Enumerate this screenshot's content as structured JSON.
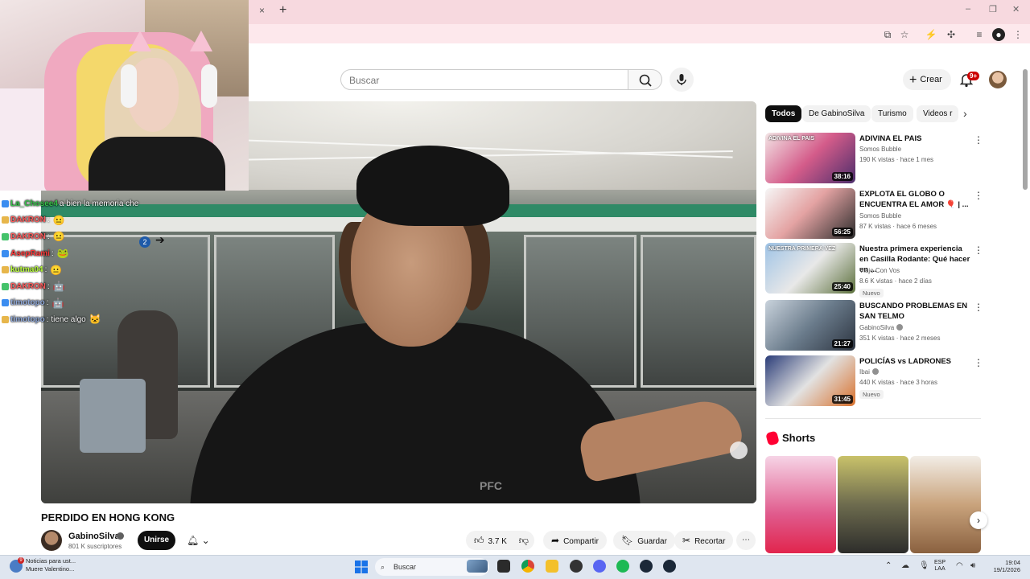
{
  "browser": {
    "tab_close": "×",
    "tab_new": "+",
    "window_controls": [
      "–",
      "❐",
      "✕"
    ]
  },
  "header": {
    "search_placeholder": "Buscar",
    "create_label": "Crear",
    "notifications_badge": "9+"
  },
  "video": {
    "title": "PERDIDO EN HONG KONG",
    "channel": "GabinoSilva",
    "subscribers": "801 K suscriptores",
    "join_label": "Unirse",
    "likes": "3.7 K",
    "share_label": "Compartir",
    "save_label": "Guardar",
    "clip_label": "Recortar",
    "logo_text": "PFC"
  },
  "chat": [
    {
      "name": "La_Chosee4",
      "msg": "a bien la memoria che",
      "color": "#35c24a",
      "emote": ""
    },
    {
      "name": "DAKRON",
      "msg": ":",
      "color": "#ff5b5b",
      "emote": "😐"
    },
    {
      "name": "DAKRON",
      "msg": ":",
      "color": "#ff5b5b",
      "emote": "😐"
    },
    {
      "name": "AsepRami",
      "msg": ":",
      "color": "#ff3a3a",
      "emote": "🐸"
    },
    {
      "name": "kutma04",
      "msg": ":",
      "color": "#b8ff3a",
      "emote": "😐"
    },
    {
      "name": "DAKRON",
      "msg": ":",
      "color": "#ff5b5b",
      "emote": "🤖"
    },
    {
      "name": "timotopo",
      "msg": ":",
      "color": "#8fa8d8",
      "emote": "🤖"
    },
    {
      "name": "timotopo",
      "msg": ": tiene algo",
      "color": "#8fa8d8",
      "emote": "🐱"
    }
  ],
  "chips": [
    {
      "label": "Todos",
      "active": true
    },
    {
      "label": "De GabinoSilva",
      "active": false
    },
    {
      "label": "Turismo",
      "active": false
    },
    {
      "label": "Videos r",
      "active": false
    }
  ],
  "recommendations": [
    {
      "title": "ADIVINA EL PAIS",
      "channel": "Somos Bubble",
      "meta": "190 K vistas · hace 1 mes",
      "duration": "38:16",
      "badge": "",
      "verified": false,
      "thumb": "linear-gradient(135deg,#f3e6e6,#d45c8a 50%,#4b2d6b)",
      "thumb_text": "ADIVINA EL PAIS"
    },
    {
      "title": "EXPLOTA EL GLOBO O ENCUENTRA EL AMOR 🎈 | ...",
      "channel": "Somos Bubble",
      "meta": "87 K vistas · hace 6 meses",
      "duration": "56:25",
      "badge": "",
      "verified": false,
      "thumb": "linear-gradient(135deg,#f6f6f6,#e4a3a3 45%,#2b2b2b)",
      "thumb_text": ""
    },
    {
      "title": "Nuestra primera experiencia en Casilla Rodante: Qué hacer en ...",
      "channel": "Viajo Con Vos",
      "meta": "8.6 K vistas · hace 2 días",
      "duration": "25:40",
      "badge": "Nuevo",
      "verified": false,
      "thumb": "linear-gradient(135deg,#9ec3e6,#e8e8e8 50%,#5b6f3a)",
      "thumb_text": "NUESTRA PRIMERA VEZ"
    },
    {
      "title": "BUSCANDO PROBLEMAS EN SAN TELMO",
      "channel": "GabinoSilva",
      "meta": "351 K vistas · hace 2 meses",
      "duration": "21:27",
      "badge": "",
      "verified": true,
      "thumb": "linear-gradient(135deg,#c9d3dc,#6b7c8c 50%,#2c3440)",
      "thumb_text": ""
    },
    {
      "title": "POLICÍAS vs LADRONES",
      "channel": "Ibai",
      "meta": "440 K vistas · hace 3 horas",
      "duration": "31:45",
      "badge": "Nuevo",
      "verified": true,
      "thumb": "linear-gradient(135deg,#2a3c78,#e2e2e2 50%,#d8702c)",
      "thumb_text": ""
    }
  ],
  "shorts": {
    "title": "Shorts",
    "items": [
      {
        "bg": "linear-gradient(180deg,#f6d4e6,#e05a8c 60%,#e1254d)"
      },
      {
        "bg": "linear-gradient(180deg,#c9c26a,#6d6b4e 50%,#2d2d2b)"
      },
      {
        "bg": "linear-gradient(180deg,#f2ede6,#c9a37c 50%,#8a6140)"
      }
    ]
  },
  "taskbar": {
    "news_title": "Noticias para ust...",
    "news_sub": "Muere Valentino...",
    "news_badge": "9",
    "search_placeholder": "Buscar",
    "lang_top": "ESP",
    "lang_bottom": "LAA",
    "time": "19:04",
    "date": "19/1/2026"
  },
  "colors": {
    "accent_red": "#ff0033",
    "tab_bar": "#f7d9df",
    "chip_active": "#0f0f0f"
  }
}
